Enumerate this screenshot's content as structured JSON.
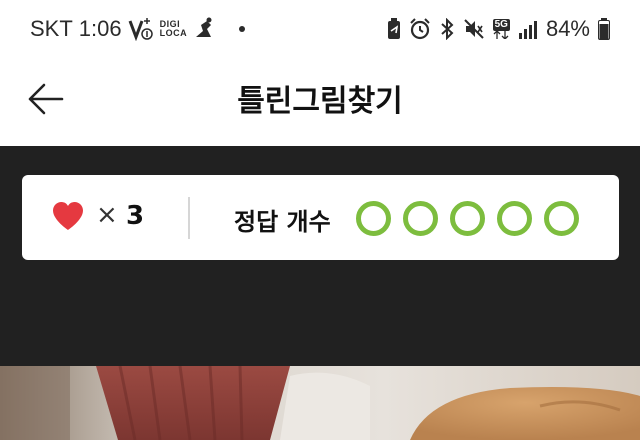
{
  "status_bar": {
    "carrier": "SKT",
    "time": "1:06",
    "digi_line1": "DIGI",
    "digi_line2": "LOCA",
    "network": "5G",
    "battery": "84%",
    "icons": [
      "volte-icon",
      "digi-loca-icon",
      "runner-icon",
      "dot-icon",
      "battery-saver-icon",
      "alarm-icon",
      "bluetooth-icon",
      "mute-icon",
      "5g-icon",
      "signal-icon",
      "battery-icon"
    ]
  },
  "header": {
    "back_icon": "arrow-left-icon",
    "title": "틀린그림찾기"
  },
  "score": {
    "heart_icon": "heart-icon",
    "heart_color": "#e53940",
    "multiplier": "×",
    "lives": "3",
    "answer_label": "정답 개수",
    "answer_slots": 5,
    "answer_color": "#7dbd3e"
  },
  "colors": {
    "dark_bg": "#212121",
    "card_bg": "#ffffff"
  }
}
